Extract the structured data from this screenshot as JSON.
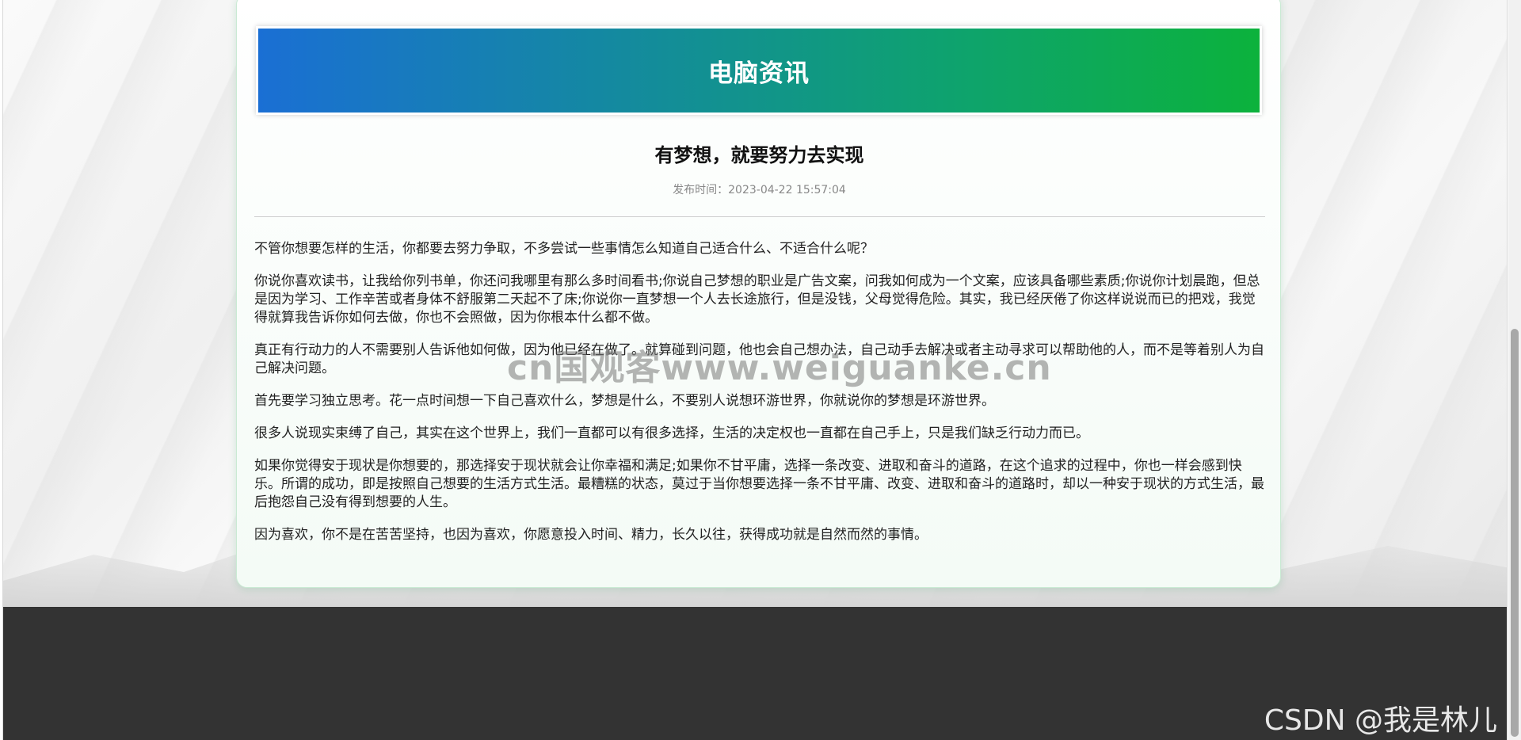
{
  "banner": {
    "title": "电脑资讯"
  },
  "article": {
    "title": "有梦想，就要努力去实现",
    "meta": "发布时间：2023-04-22 15:57:04",
    "paragraphs": [
      "不管你想要怎样的生活，你都要去努力争取，不多尝试一些事情怎么知道自己适合什么、不适合什么呢？",
      "你说你喜欢读书，让我给你列书单，你还问我哪里有那么多时间看书;你说自己梦想的职业是广告文案，问我如何成为一个文案，应该具备哪些素质;你说你计划晨跑，但总是因为学习、工作辛苦或者身体不舒服第二天起不了床;你说你一直梦想一个人去长途旅行，但是没钱，父母觉得危险。其实，我已经厌倦了你这样说说而已的把戏，我觉得就算我告诉你如何去做，你也不会照做，因为你根本什么都不做。",
      "真正有行动力的人不需要别人告诉他如何做，因为他已经在做了。就算碰到问题，他也会自己想办法，自己动手去解决或者主动寻求可以帮助他的人，而不是等着别人为自己解决问题。",
      "首先要学习独立思考。花一点时间想一下自己喜欢什么，梦想是什么，不要别人说想环游世界，你就说你的梦想是环游世界。",
      "很多人说现实束缚了自己，其实在这个世界上，我们一直都可以有很多选择，生活的决定权也一直都在自己手上，只是我们缺乏行动力而已。",
      "如果你觉得安于现状是你想要的，那选择安于现状就会让你幸福和满足;如果你不甘平庸，选择一条改变、进取和奋斗的道路，在这个追求的过程中，你也一样会感到快乐。所谓的成功，即是按照自己想要的生活方式生活。最糟糕的状态，莫过于当你想要选择一条不甘平庸、改变、进取和奋斗的道路时，却以一种安于现状的方式生活，最后抱怨自己没有得到想要的人生。",
      "因为喜欢，你不是在苦苦坚持，也因为喜欢，你愿意投入时间、精力，长久以往，获得成功就是自然而然的事情。"
    ]
  },
  "watermark": {
    "text": "cn国观客www.weiguanke.cn"
  },
  "csdn": {
    "text": "CSDN @我是林儿"
  }
}
